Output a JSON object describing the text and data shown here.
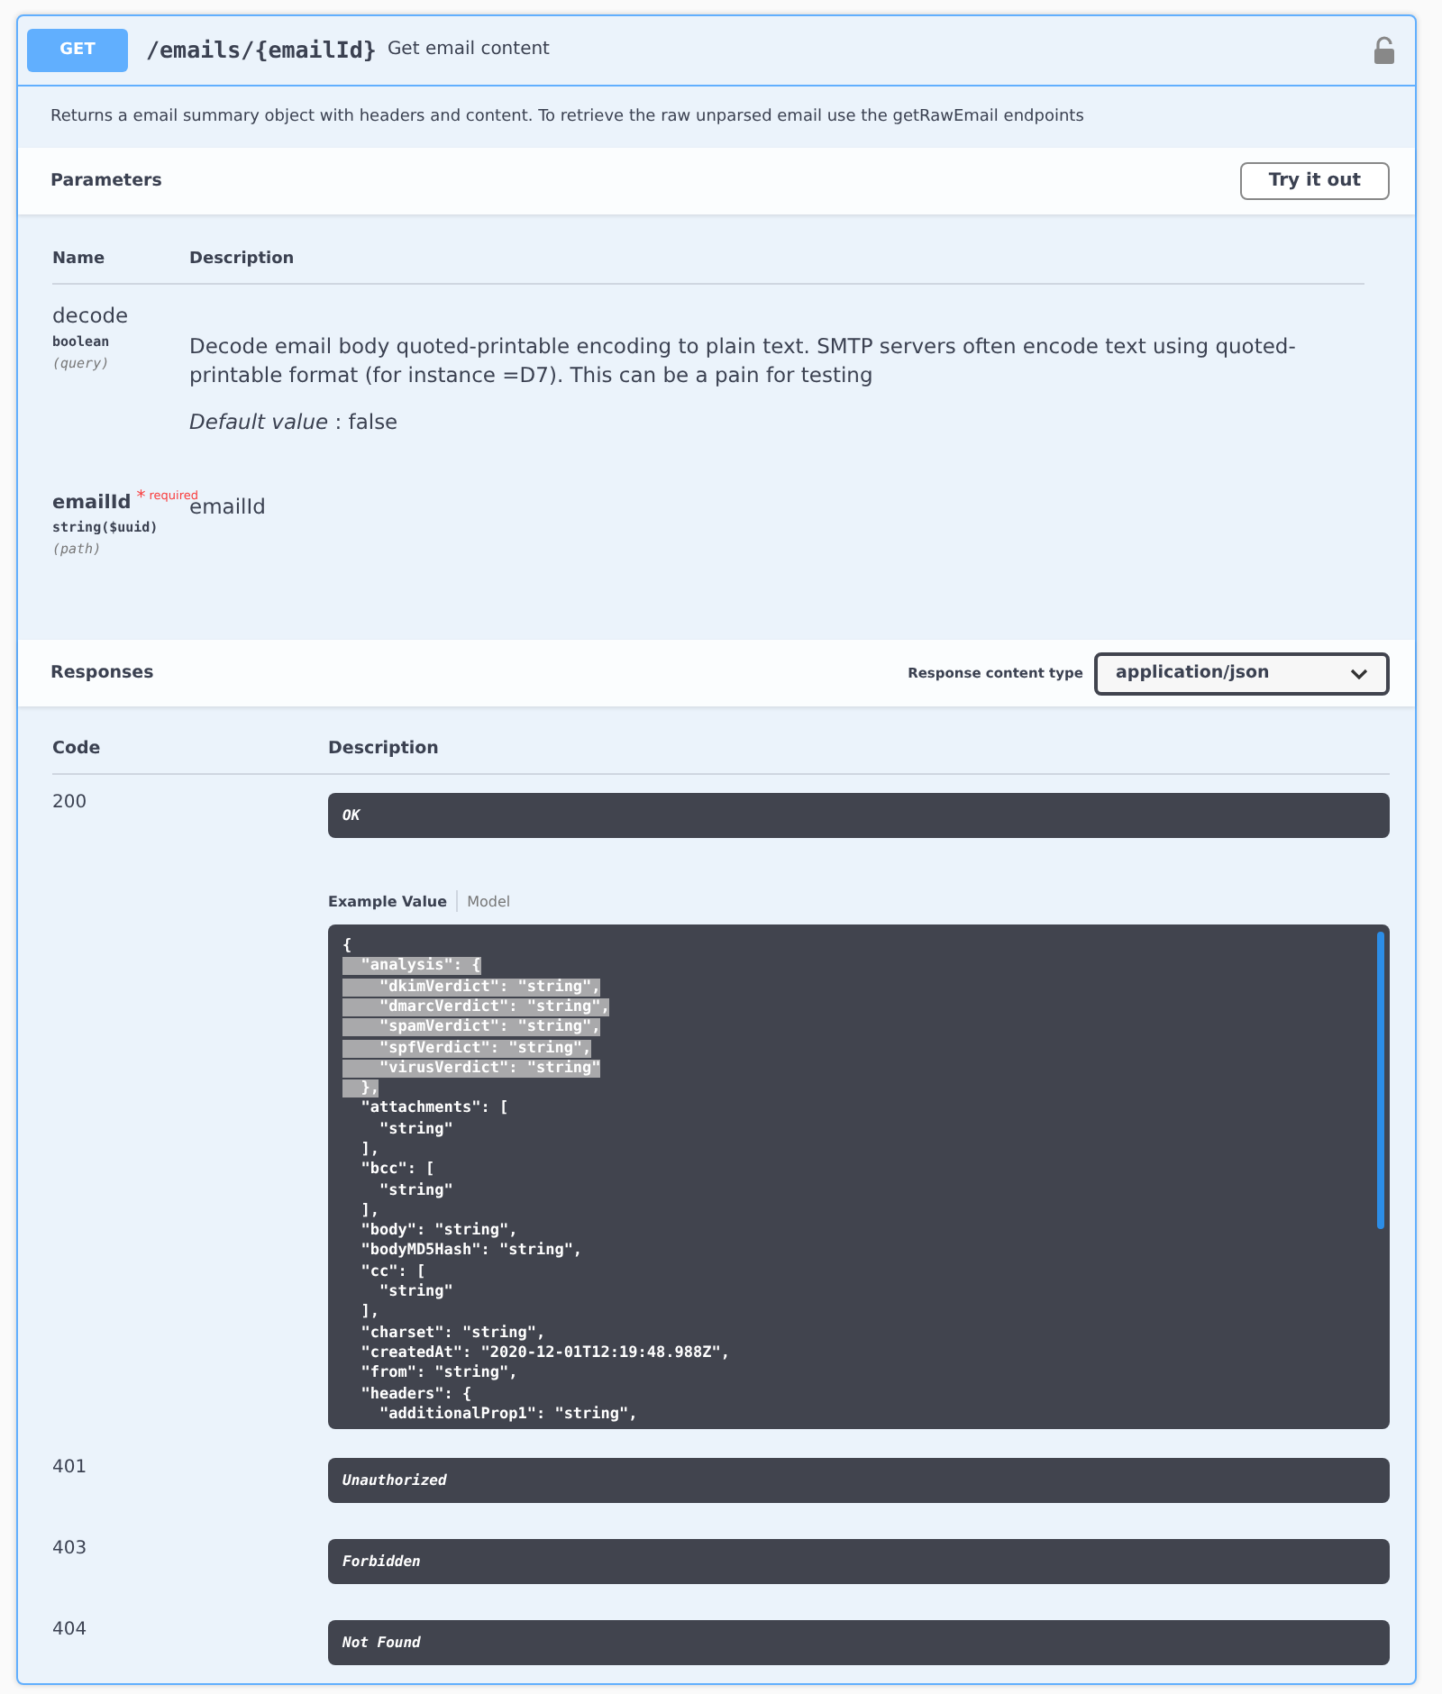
{
  "operation": {
    "method": "GET",
    "path": "/emails/{emailId}",
    "summary": "Get email content",
    "locked": false,
    "description": "Returns a email summary object with headers and content. To retrieve the raw unparsed email use the getRawEmail endpoints"
  },
  "parameters": {
    "title": "Parameters",
    "try_button": "Try it out",
    "columns": [
      "Name",
      "Description"
    ],
    "rows": [
      {
        "name": "decode",
        "type": "boolean",
        "location": "(query)",
        "description": "Decode email body quoted-printable encoding to plain text. SMTP servers often encode text using quoted-printable format (for instance =D7). This can be a pain for testing",
        "default_label": "Default value",
        "default_value": ": false"
      },
      {
        "name": "emailId",
        "required_mark": "*",
        "required_label": "required",
        "type": "string($uuid)",
        "location": "(path)",
        "description": "emailId"
      }
    ]
  },
  "responses": {
    "title": "Responses",
    "content_type_label": "Response content type",
    "content_type": "application/json",
    "columns": [
      "Code",
      "Description"
    ],
    "rows": [
      {
        "code": "200",
        "description": "OK",
        "example_tabs": [
          {
            "label": "Example Value",
            "selected": true
          },
          {
            "label": "Model",
            "selected": false
          }
        ],
        "example_lines": [
          {
            "text": "{",
            "highlighted": false
          },
          {
            "text": "  \"analysis\": {",
            "highlighted": true
          },
          {
            "text": "    \"dkimVerdict\": \"string\",",
            "highlighted": true
          },
          {
            "text": "    \"dmarcVerdict\": \"string\",",
            "highlighted": true
          },
          {
            "text": "    \"spamVerdict\": \"string\",",
            "highlighted": true
          },
          {
            "text": "    \"spfVerdict\": \"string\",",
            "highlighted": true
          },
          {
            "text": "    \"virusVerdict\": \"string\"",
            "highlighted": true
          },
          {
            "text": "  },",
            "highlighted": true
          },
          {
            "text": "  \"attachments\": [",
            "highlighted": false
          },
          {
            "text": "    \"string\"",
            "highlighted": false
          },
          {
            "text": "  ],",
            "highlighted": false
          },
          {
            "text": "  \"bcc\": [",
            "highlighted": false
          },
          {
            "text": "    \"string\"",
            "highlighted": false
          },
          {
            "text": "  ],",
            "highlighted": false
          },
          {
            "text": "  \"body\": \"string\",",
            "highlighted": false
          },
          {
            "text": "  \"bodyMD5Hash\": \"string\",",
            "highlighted": false
          },
          {
            "text": "  \"cc\": [",
            "highlighted": false
          },
          {
            "text": "    \"string\"",
            "highlighted": false
          },
          {
            "text": "  ],",
            "highlighted": false
          },
          {
            "text": "  \"charset\": \"string\",",
            "highlighted": false
          },
          {
            "text": "  \"createdAt\": \"2020-12-01T12:19:48.988Z\",",
            "highlighted": false
          },
          {
            "text": "  \"from\": \"string\",",
            "highlighted": false
          },
          {
            "text": "  \"headers\": {",
            "highlighted": false
          },
          {
            "text": "    \"additionalProp1\": \"string\",",
            "highlighted": false
          }
        ]
      },
      {
        "code": "401",
        "description": "Unauthorized"
      },
      {
        "code": "403",
        "description": "Forbidden"
      },
      {
        "code": "404",
        "description": "Not Found"
      }
    ]
  }
}
